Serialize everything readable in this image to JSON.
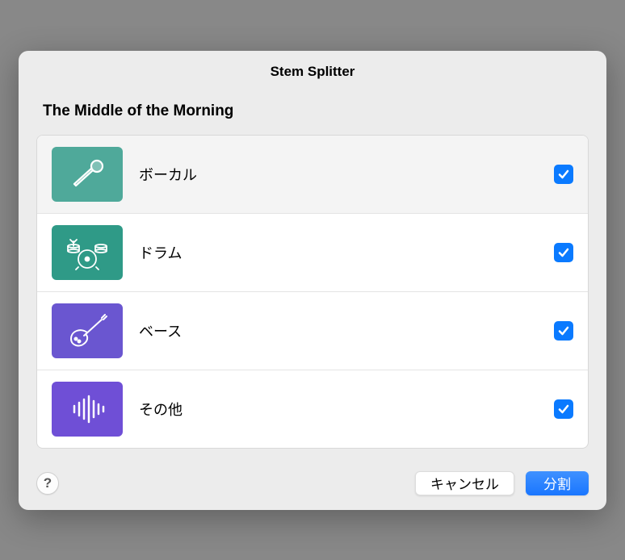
{
  "title": "Stem Splitter",
  "song_title": "The Middle of the Morning",
  "stems": [
    {
      "label": "ボーカル",
      "checked": true
    },
    {
      "label": "ドラム",
      "checked": true
    },
    {
      "label": "ベース",
      "checked": true
    },
    {
      "label": "その他",
      "checked": true
    }
  ],
  "buttons": {
    "help": "?",
    "cancel": "キャンセル",
    "split": "分割"
  }
}
